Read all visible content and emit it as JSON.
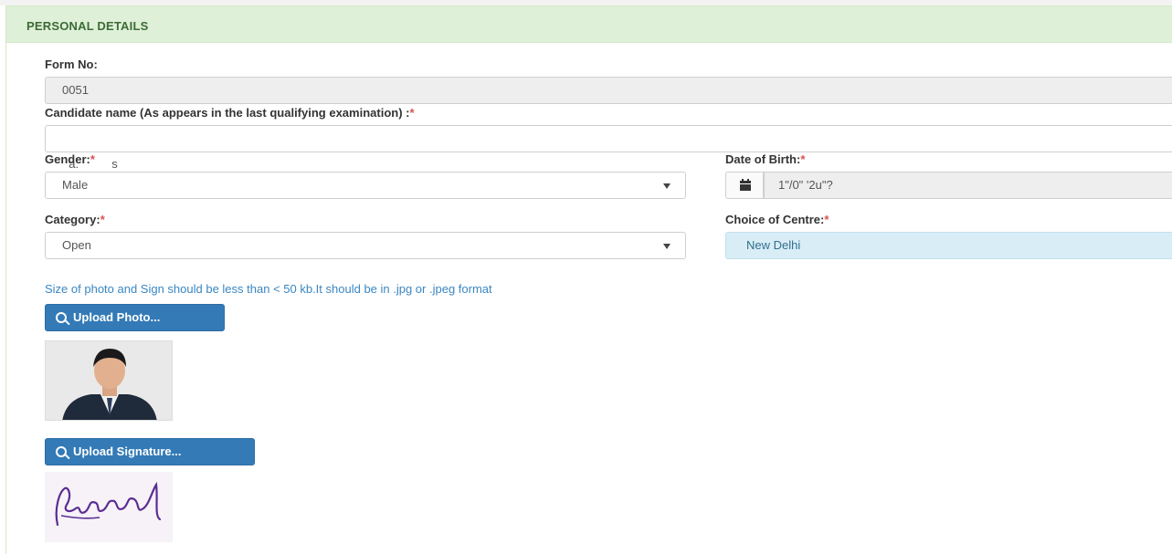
{
  "panel": {
    "title": "PERSONAL DETAILS"
  },
  "form_no": {
    "label": "Form No:",
    "value": "0051"
  },
  "candidate_name": {
    "label": "Candidate name (As appears in the last qualifying examination) :",
    "required_mark": "*",
    "value": "a:          s"
  },
  "gender": {
    "label": "Gender:",
    "required_mark": "*",
    "value": "Male"
  },
  "dob": {
    "label": "Date of Birth:",
    "required_mark": "*",
    "value": "1\"/0\" '2u\"?",
    "icon": "calendar-icon"
  },
  "category": {
    "label": "Category:",
    "required_mark": "*",
    "value": "Open"
  },
  "centre": {
    "label": "Choice of Centre:",
    "required_mark": "*",
    "value": "New Delhi"
  },
  "upload": {
    "help_text": "Size of photo and Sign should be less than < 50 kb.It should be in .jpg or .jpeg format",
    "photo_button": "Upload Photo...",
    "signature_button": "Upload Signature...",
    "button_icon": "search-icon"
  },
  "colors": {
    "heading_bg": "#dff0d8",
    "primary": "#337ab7",
    "required": "#d9534f",
    "help": "#3a87c2",
    "info_bg": "#d9edf7"
  }
}
